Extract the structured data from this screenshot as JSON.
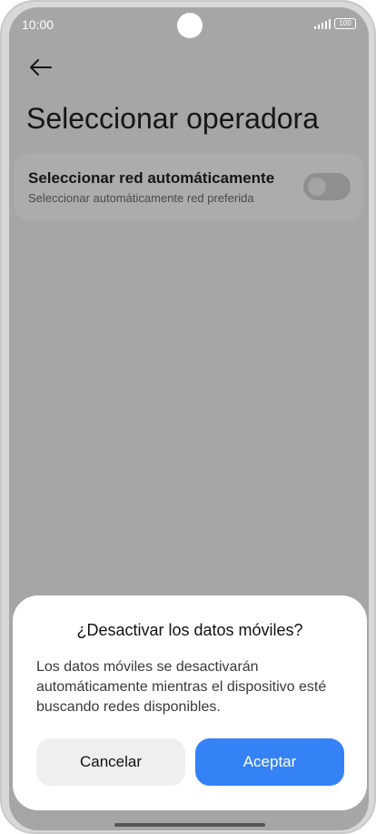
{
  "status_bar": {
    "time": "10:00",
    "battery": "100"
  },
  "header": {
    "back_icon": "arrow-left-icon",
    "title": "Seleccionar operadora"
  },
  "settings": {
    "auto_network": {
      "title": "Seleccionar red automáticamente",
      "subtitle": "Seleccionar automáticamente red preferida",
      "enabled": false
    }
  },
  "dialog": {
    "title": "¿Desactivar los datos móviles?",
    "message": "Los datos móviles se desactivarán automáticamente mientras el dispositivo esté buscando redes disponibles.",
    "cancel_label": "Cancelar",
    "accept_label": "Aceptar"
  },
  "colors": {
    "accent": "#3482f6",
    "scrim_background": "#a6a6a6",
    "dialog_background": "#ffffff"
  }
}
